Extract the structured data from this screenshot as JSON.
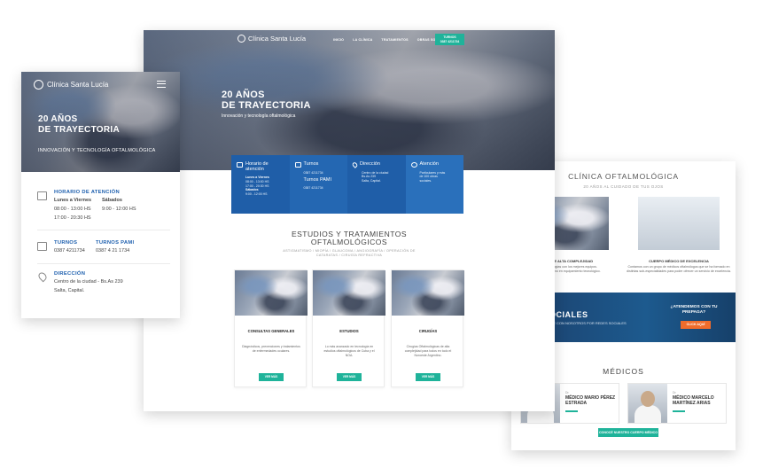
{
  "right_card": {
    "section_title": "CLÍNICA OFTALMOLÓGICA",
    "section_subtitle": "20 AÑOS AL CUIDADO DE TUS OJOS",
    "feature_left_caption": "TECNOLOGÍA DE ALTA COMPLEJIDAD",
    "feature_left_text": "Tratamientos y cirugías con los mejores equipos. Contamos con lo último en equipamiento tecnológico.",
    "feature_right_caption": "CUERPO MÉDICO DE EXCELENCIA",
    "feature_right_text": "Contamos con un grupo de médicos oftalmólogos que se ha formado en distintas sub-especialidades para poder ofrecer un servicio de excelencia.",
    "banner_big": "REDES SOCIALES",
    "banner_small": "SEGUINOS Y CONECTATE CON NOSOTROS POR REDES SOCIALES",
    "banner_question": "¿ATENDEMOS CON TU PREPAGA?",
    "banner_button": "CLICK AQUÍ",
    "medicos_title": "MÉDICOS",
    "doctors": [
      {
        "label": "Dr. ",
        "name": "MÉDICO MARIO PÉREZ ESTRADA"
      },
      {
        "label": "Dr. ",
        "name": "MÉDICO MARCELO MARTÍNEZ ARIAS"
      }
    ],
    "cta_button": "CONOCÉ NUESTRO CUERPO MÉDICO"
  },
  "center_card": {
    "logo_text": "Clínica Santa Lucía",
    "nav": [
      "INICIO",
      "LA CLÍNICA",
      "TRATAMIENTOS",
      "OBRAS SOCIALES"
    ],
    "nav_button_line1": "TURNOS",
    "nav_button_line2": "0387 4211734",
    "hero_title_line1": "20 AÑOS",
    "hero_title_line2": "DE TRAYECTORIA",
    "hero_subtitle": "Innovación y tecnología oftalmológica",
    "info": [
      {
        "title": "Horario de atención",
        "lines": [
          "Lunes a Viernes",
          "08:00 - 13:00 HS",
          "17:00 - 20:30 HS",
          "Sábados",
          "9:00 - 12:00 HS"
        ]
      },
      {
        "title": "Turnos",
        "lines": [
          "0387 4211734"
        ],
        "title2": "Turnos PAMI",
        "lines2": [
          "0387 4211734"
        ]
      },
      {
        "title": "Dirección",
        "lines": [
          "Centro de la ciudad",
          "Bs.As 239",
          "Salta, Capital."
        ]
      },
      {
        "title": "Atención",
        "lines": [
          "Particulares y más",
          "de 100 obras",
          "sociales."
        ]
      }
    ],
    "section_title_line1": "ESTUDIOS Y TRATAMIENTOS",
    "section_title_line2": "OFTALMOLÓGICOS",
    "section_subtitle": "ASTIGMATISMO / MIOPÍA / GLAUCOMA / ANGIOGRAFÍA / OPERACIÓN DE CATARATAS / CIRUGÍA REFRACTIVA",
    "services": [
      {
        "title": "CONSULTAS GENERALES",
        "desc": "Diagnósticos, prevenciones y tratamientos de enfermedades oculares.",
        "button": "VER MÁS"
      },
      {
        "title": "ESTUDIOS",
        "desc": "Lo más avanzado en tecnología en estudios oftalmológicos de Cuba y el NOA.",
        "button": "VER MÁS"
      },
      {
        "title": "CIRUGÍAS",
        "desc": "Cirugías Oftalmológicas de alta complejidad para todos en todo el Noroeste Argentino.",
        "button": "VER MÁS"
      }
    ]
  },
  "left_card": {
    "logo_text": "Clínica Santa Lucía",
    "hero_title_line1": "20 AÑOS",
    "hero_title_line2": "DE TRAYECTORIA",
    "hero_subtitle": "INNOVACIÓN Y TECNOLOGÍA OFTALMOLÓGICA",
    "horario_heading": "HORARIO DE ATENCIÓN",
    "horario_days_a": "Lunes a Viernes",
    "horario_days_b": "Sábados",
    "horario_line1_a": "08:00 - 13:00 HS",
    "horario_line1_b": "9:00 - 12:00 HS",
    "horario_line2_a": "17:00 - 20:30 HS",
    "turnos_heading": "TURNOS",
    "turnos_value": "0387 4211734",
    "pami_heading": "TURNOS PAMI",
    "pami_value": "0387 4 21 1734",
    "direccion_heading": "DIRECCIÓN",
    "direccion_line1": "Centro de la ciudad - Bs.As 239",
    "direccion_line2": "Salta, Capital."
  },
  "colors": {
    "accent_teal": "#1fb39a",
    "brand_blue": "#1d5fae",
    "orange": "#ef6c2b"
  }
}
